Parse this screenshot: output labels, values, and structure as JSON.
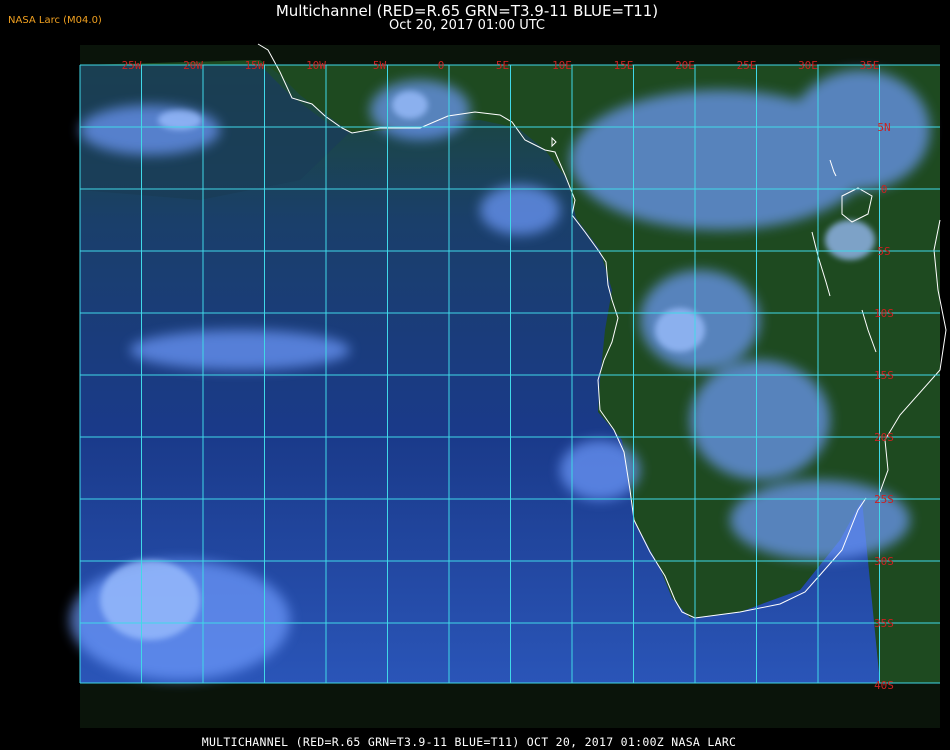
{
  "header": {
    "tag": "NASA Larc (M04.0)",
    "title": "Multichannel (RED=R.65 GRN=T3.9-11 BLUE=T11)",
    "subtitle": "Oct 20, 2017 01:00 UTC"
  },
  "footer": {
    "caption": "MULTICHANNEL (RED=R.65 GRN=T3.9-11 BLUE=T11) OCT 20, 2017 01:00Z   NASA LARC"
  },
  "map": {
    "longitude_labels": [
      "25W",
      "20W",
      "15W",
      "10W",
      "5W",
      "0",
      "5E",
      "10E",
      "15E",
      "20E",
      "25E",
      "30E",
      "35E"
    ],
    "latitude_labels": [
      "5N",
      "0",
      "5S",
      "10S",
      "15S",
      "20S",
      "25S",
      "30S",
      "35S",
      "40S"
    ],
    "colors": {
      "grid": "#40d8e8",
      "labels": "#cc2020",
      "coastline": "#ffffff",
      "ocean": "#1a3f8c",
      "land": "#1f4a22",
      "cloud": "#8ab4ff"
    }
  }
}
